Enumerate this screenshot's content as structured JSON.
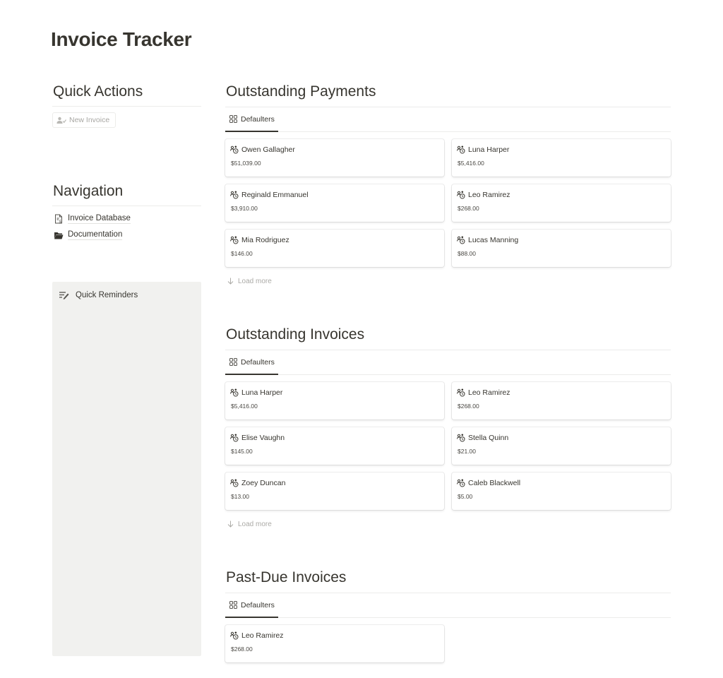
{
  "page": {
    "title": "Invoice Tracker"
  },
  "quick_actions": {
    "heading": "Quick Actions",
    "new_invoice_label": "New Invoice"
  },
  "navigation": {
    "heading": "Navigation",
    "items": [
      {
        "label": "Invoice Database",
        "icon": "document-icon"
      },
      {
        "label": "Documentation",
        "icon": "folder-icon"
      }
    ]
  },
  "reminders": {
    "label": "Quick Reminders",
    "icon": "list-edit-icon"
  },
  "sections": [
    {
      "heading": "Outstanding Payments",
      "tab": "Defaulters",
      "load_more": "Load more",
      "cards": [
        {
          "name": "Owen Gallagher",
          "amount": "$51,039.00"
        },
        {
          "name": "Luna Harper",
          "amount": "$5,416.00"
        },
        {
          "name": "Reginald Emmanuel",
          "amount": "$3,910.00"
        },
        {
          "name": "Leo Ramirez",
          "amount": "$268.00"
        },
        {
          "name": "Mia Rodriguez",
          "amount": "$146.00"
        },
        {
          "name": "Lucas Manning",
          "amount": "$88.00"
        }
      ]
    },
    {
      "heading": "Outstanding Invoices",
      "tab": "Defaulters",
      "load_more": "Load more",
      "cards": [
        {
          "name": "Luna Harper",
          "amount": "$5,416.00"
        },
        {
          "name": "Leo Ramirez",
          "amount": "$268.00"
        },
        {
          "name": "Elise Vaughn",
          "amount": "$145.00"
        },
        {
          "name": "Stella Quinn",
          "amount": "$21.00"
        },
        {
          "name": "Zoey Duncan",
          "amount": "$13.00"
        },
        {
          "name": "Caleb Blackwell",
          "amount": "$5.00"
        }
      ]
    },
    {
      "heading": "Past-Due Invoices",
      "tab": "Defaulters",
      "cards": [
        {
          "name": "Leo Ramirez",
          "amount": "$268.00"
        }
      ]
    }
  ]
}
